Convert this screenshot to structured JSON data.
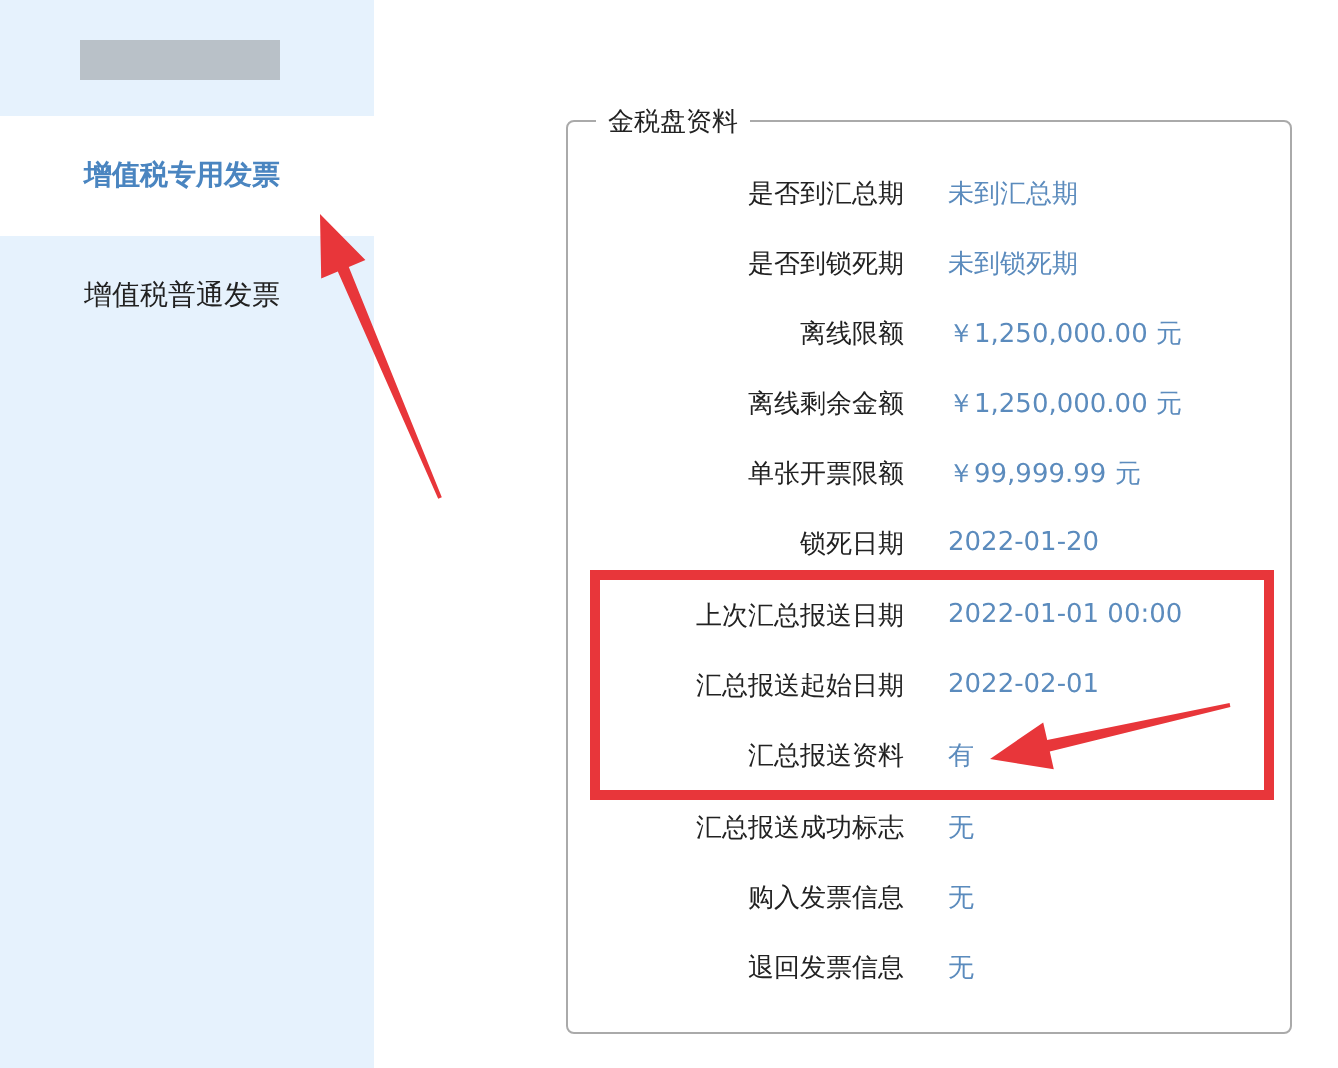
{
  "sidebar": {
    "items": [
      {
        "label": "增值税专用发票",
        "selected": true,
        "arrow": true
      },
      {
        "label": "增值税普通发票",
        "selected": false,
        "arrow": false
      }
    ]
  },
  "panel": {
    "title": "金税盘资料",
    "rows": [
      {
        "label": "是否到汇总期",
        "value": "未到汇总期",
        "highlighted": false,
        "arrow": false
      },
      {
        "label": "是否到锁死期",
        "value": "未到锁死期",
        "highlighted": false,
        "arrow": false
      },
      {
        "label": "离线限额",
        "value": "￥1,250,000.00 元",
        "highlighted": false,
        "arrow": false
      },
      {
        "label": "离线剩余金额",
        "value": "￥1,250,000.00 元",
        "highlighted": false,
        "arrow": false
      },
      {
        "label": "单张开票限额",
        "value": "￥99,999.99 元",
        "highlighted": false,
        "arrow": false
      },
      {
        "label": "锁死日期",
        "value": "2022-01-20",
        "highlighted": false,
        "arrow": false
      },
      {
        "label": "上次汇总报送日期",
        "value": "2022-01-01 00:00",
        "highlighted": true,
        "arrow": false
      },
      {
        "label": "汇总报送起始日期",
        "value": "2022-02-01",
        "highlighted": true,
        "arrow": false
      },
      {
        "label": "汇总报送资料",
        "value": "有",
        "highlighted": true,
        "arrow": true
      },
      {
        "label": "汇总报送成功标志",
        "value": "无",
        "highlighted": false,
        "arrow": false
      },
      {
        "label": "购入发票信息",
        "value": "无",
        "highlighted": false,
        "arrow": false
      },
      {
        "label": "退回发票信息",
        "value": "无",
        "highlighted": false,
        "arrow": false
      }
    ]
  }
}
